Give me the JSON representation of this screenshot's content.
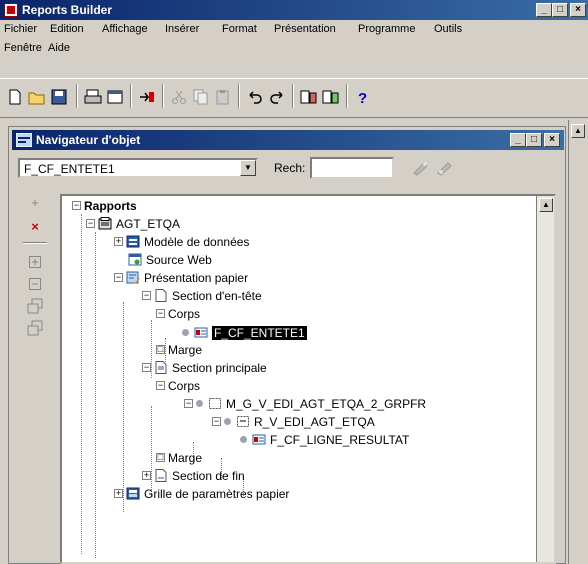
{
  "app": {
    "title": "Reports Builder",
    "controls": [
      "_",
      "□",
      "×"
    ]
  },
  "menu": {
    "items": [
      "Fichier",
      "Edition",
      "Affichage",
      "Insérer",
      "Format",
      "Présentation",
      "Programme",
      "Outils",
      "Fenêtre",
      "Aide"
    ]
  },
  "navigator": {
    "title": "Navigateur d'objet",
    "controls": [
      "_",
      "□",
      "×"
    ],
    "selected_object": "F_CF_ENTETE1",
    "search_label": "Rech:",
    "search_value": ""
  },
  "sidebar_icons": [
    "add-icon",
    "delete-icon",
    "expand-icon",
    "collapse-icon",
    "expand-all-icon",
    "collapse-all-icon"
  ],
  "tree": {
    "nodes": [
      {
        "label": "Rapports",
        "level": 0,
        "expander": "−",
        "icon": "none",
        "bold": true
      },
      {
        "label": "AGT_ETQA",
        "level": 1,
        "expander": "−",
        "icon": "report-icon"
      },
      {
        "label": "Modèle de données",
        "level": 2,
        "expander": "+",
        "icon": "datamodel-icon"
      },
      {
        "label": "Source Web",
        "level": 2,
        "expander": "",
        "icon": "websource-icon"
      },
      {
        "label": "Présentation papier",
        "level": 2,
        "expander": "−",
        "icon": "layout-icon"
      },
      {
        "label": "Section d'en-tête",
        "level": 3,
        "expander": "−",
        "icon": "page-icon"
      },
      {
        "label": "Corps",
        "level": 4,
        "expander": "−",
        "icon": "none"
      },
      {
        "label": "F_CF_ENTETE1",
        "level": 5,
        "expander": "",
        "icon": "field-icon",
        "selected": true
      },
      {
        "label": "Marge",
        "level": 4,
        "expander": "□",
        "icon": "none"
      },
      {
        "label": "Section principale",
        "level": 3,
        "expander": "−",
        "icon": "page-icon"
      },
      {
        "label": "Corps",
        "level": 4,
        "expander": "−",
        "icon": "none"
      },
      {
        "label": "M_G_V_EDI_AGT_ETQA_2_GRPFR",
        "level": 5,
        "expander": "−",
        "icon": "frame-icon"
      },
      {
        "label": "R_V_EDI_AGT_ETQA",
        "level": 6,
        "expander": "−",
        "icon": "repeat-frame-icon"
      },
      {
        "label": "F_CF_LIGNE_RESULTAT",
        "level": 7,
        "expander": "",
        "icon": "field-icon"
      },
      {
        "label": "Marge",
        "level": 4,
        "expander": "□",
        "icon": "none"
      },
      {
        "label": "Section de fin",
        "level": 3,
        "expander": "+",
        "icon": "page-icon"
      },
      {
        "label": "Grille de paramètres papier",
        "level": 2,
        "expander": "+",
        "icon": "param-icon"
      }
    ]
  },
  "colors": {
    "titlebar_start": "#0a246a",
    "titlebar_end": "#3a6ea5",
    "selection_bg": "#000000",
    "window_bg": "#d4d0c8"
  }
}
